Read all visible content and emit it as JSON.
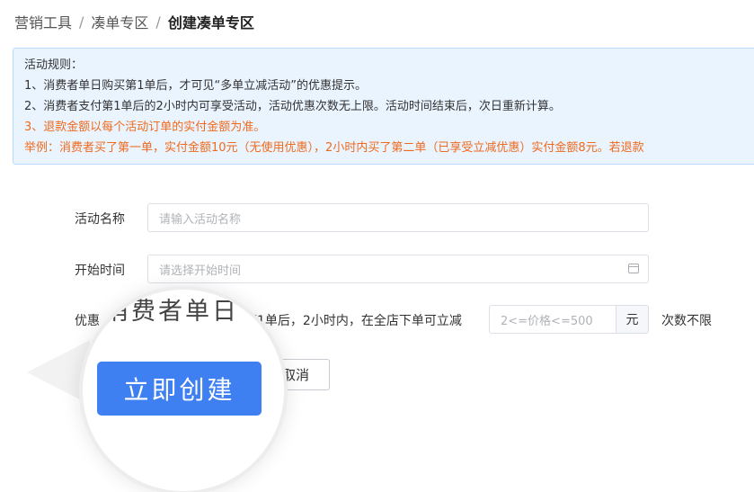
{
  "breadcrumb": {
    "items": [
      "营销工具",
      "凑单专区"
    ],
    "current": "创建凑单专区",
    "separator": "/"
  },
  "rules": {
    "title": "活动规则：",
    "line1": "1、消费者单日购买第1单后，才可见“多单立减活动”的优惠提示。",
    "line2": "2、消费者支付第1单后的2小时内可享受活动，活动优惠次数无上限。活动时间结束后，次日重新计算。",
    "line3": "3、退款金额以每个活动订单的实付金额为准。",
    "line4": "举例：消费者买了第一单，实付金额10元（无使用优惠），2小时内买了第二单（已享受立减优惠）实付金额8元。若退款"
  },
  "form": {
    "name_label": "活动名称",
    "name_placeholder": "请输入活动名称",
    "start_label": "开始时间",
    "start_placeholder": "请选择开始时间",
    "discount_label_start": "优惠",
    "discount_text": "第1单后，2小时内，在全店下单可立减",
    "price_placeholder": "2<=价格<=500",
    "unit": "元",
    "limit_text": "次数不限"
  },
  "magnifier": {
    "text": "消费者单日",
    "create_label": "立即创建"
  },
  "actions": {
    "cancel_label": "取消"
  },
  "colors": {
    "primary": "#3e7ff2",
    "warning": "#ef6a1d",
    "info_bg": "#eaf4ff"
  }
}
